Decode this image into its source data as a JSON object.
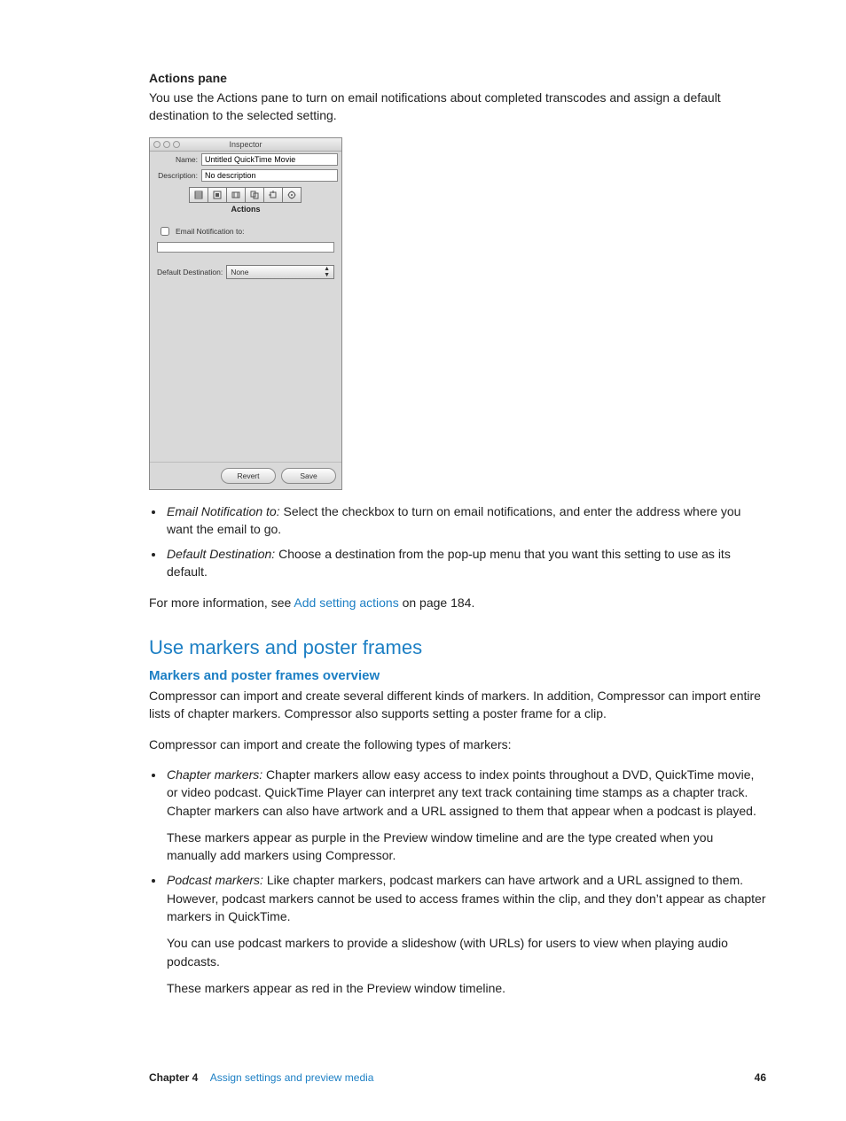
{
  "heading": "Actions pane",
  "intro": "You use the Actions pane to turn on email notifications about completed transcodes and assign a default destination to the selected setting.",
  "inspector": {
    "window_title": "Inspector",
    "name_label": "Name:",
    "name_value": "Untitled QuickTime Movie",
    "desc_label": "Description:",
    "desc_value": "No description",
    "tab_label": "Actions",
    "email_label": "Email Notification to:",
    "dest_label": "Default Destination:",
    "dest_value": "None",
    "revert": "Revert",
    "save": "Save"
  },
  "bullets_a": [
    {
      "term": "Email Notification to:",
      "text": " Select the checkbox to turn on email notifications, and enter the address where you want the email to go."
    },
    {
      "term": "Default Destination:",
      "text": " Choose a destination from the pop-up menu that you want this setting to use as its default."
    }
  ],
  "more_info_prefix": "For more information, see ",
  "more_info_link": "Add setting actions",
  "more_info_suffix": " on page 184.",
  "section_title": "Use markers and poster frames",
  "subsection_title": "Markers and poster frames overview",
  "overview_p1": "Compressor can import and create several different kinds of markers. In addition, Compressor can import entire lists of chapter markers. Compressor also supports setting a poster frame for a clip.",
  "overview_p2": "Compressor can import and create the following types of markers:",
  "bullets_b": [
    {
      "term": "Chapter markers:",
      "text": " Chapter markers allow easy access to index points throughout a DVD, QuickTime movie, or video podcast. QuickTime Player can interpret any text track containing time stamps as a chapter track. Chapter markers can also have artwork and a URL assigned to them that appear when a podcast is played.",
      "sub": [
        "These markers appear as purple in the Preview window timeline and are the type created when you manually add markers using Compressor."
      ]
    },
    {
      "term": "Podcast markers:",
      "text": " Like chapter markers, podcast markers can have artwork and a URL assigned to them. However, podcast markers cannot be used to access frames within the clip, and they don’t appear as chapter markers in QuickTime.",
      "sub": [
        "You can use podcast markers to provide a slideshow (with URLs) for users to view when playing audio podcasts.",
        "These markers appear as red in the Preview window timeline."
      ]
    }
  ],
  "footer": {
    "chapter_label": "Chapter  4",
    "chapter_title": "Assign settings and preview media",
    "page": "46"
  }
}
